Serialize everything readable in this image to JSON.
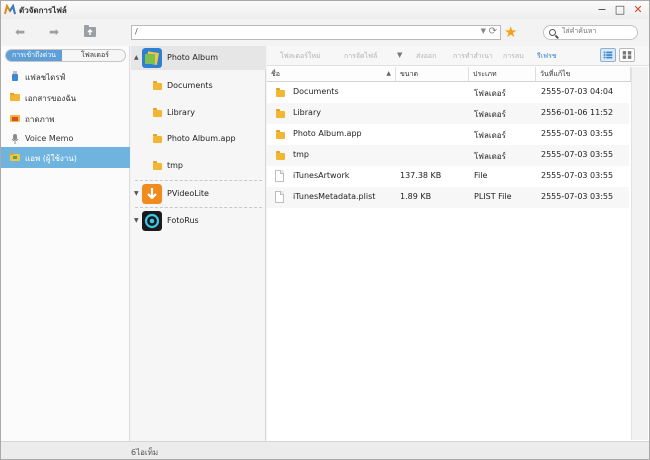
{
  "titlebar": {
    "title": "ตัวจัดการไฟล์",
    "minimize": "−",
    "maximize": "□",
    "close": "✕"
  },
  "toolbar": {
    "back": "⬅",
    "forward": "➡",
    "address": "/",
    "address_dropdown": "▼",
    "refresh": "⟳",
    "favorite": "★",
    "search_placeholder": "ใส่คำค้นหา"
  },
  "left_panel": {
    "tabs": [
      "การเข้าถึงด่วน",
      "โฟลเดอร์"
    ],
    "items": [
      {
        "label": "แฟลชไดรฟ์",
        "icon": "usb-drive-icon",
        "selected": false
      },
      {
        "label": "เอกสารของฉัน",
        "icon": "documents-icon",
        "selected": false
      },
      {
        "label": "ถาดภาพ",
        "icon": "camera-roll-icon",
        "selected": false
      },
      {
        "label": "Voice Memo",
        "icon": "microphone-icon",
        "selected": false
      },
      {
        "label": "แอพ (ผู้ใช้งาน)",
        "icon": "apps-folder-icon",
        "selected": true
      }
    ]
  },
  "mid_panel": {
    "apps": [
      {
        "name": "Photo Album",
        "icon": "photo-album-app-icon",
        "expanded": true,
        "children": [
          "Documents",
          "Library",
          "Photo Album.app",
          "tmp"
        ]
      },
      {
        "name": "PVideoLite",
        "icon": "pvideolite-app-icon",
        "expanded": false
      },
      {
        "name": "FotoRus",
        "icon": "fotorus-app-icon",
        "expanded": false
      }
    ]
  },
  "actions": {
    "new_folder": "โฟลเดอร์ใหม่",
    "manage_files": "การจัดไฟล์",
    "manage_dropdown": "▼",
    "delete": "ส่งออก",
    "rename": "การทำสำเนา",
    "properties": "การลบ",
    "refresh": "รีเฟรช"
  },
  "table": {
    "columns": [
      "ชื่อ",
      "ขนาด",
      "ประเภท",
      "วันที่แก้ไข"
    ],
    "sort_indicator": "▲",
    "rows": [
      {
        "name": "Documents",
        "size": "",
        "type": "โฟลเดอร์",
        "modified": "2555-07-03 04:04",
        "kind": "folder"
      },
      {
        "name": "Library",
        "size": "",
        "type": "โฟลเดอร์",
        "modified": "2556-01-06 11:52",
        "kind": "folder"
      },
      {
        "name": "Photo Album.app",
        "size": "",
        "type": "โฟลเดอร์",
        "modified": "2555-07-03 03:55",
        "kind": "folder"
      },
      {
        "name": "tmp",
        "size": "",
        "type": "โฟลเดอร์",
        "modified": "2555-07-03 03:55",
        "kind": "folder"
      },
      {
        "name": "iTunesArtwork",
        "size": "137.38 KB",
        "type": "File",
        "modified": "2555-07-03 03:55",
        "kind": "file"
      },
      {
        "name": "iTunesMetadata.plist",
        "size": "1.89 KB",
        "type": "PLIST File",
        "modified": "2555-07-03 03:55",
        "kind": "file"
      }
    ]
  },
  "status": {
    "text": "6ไอเท็ม"
  },
  "colors": {
    "accent": "#5d9fd6",
    "selected_row": "#6fb4de",
    "folder": "#f2b632",
    "star": "#f2a31a",
    "close": "#d9442c"
  }
}
